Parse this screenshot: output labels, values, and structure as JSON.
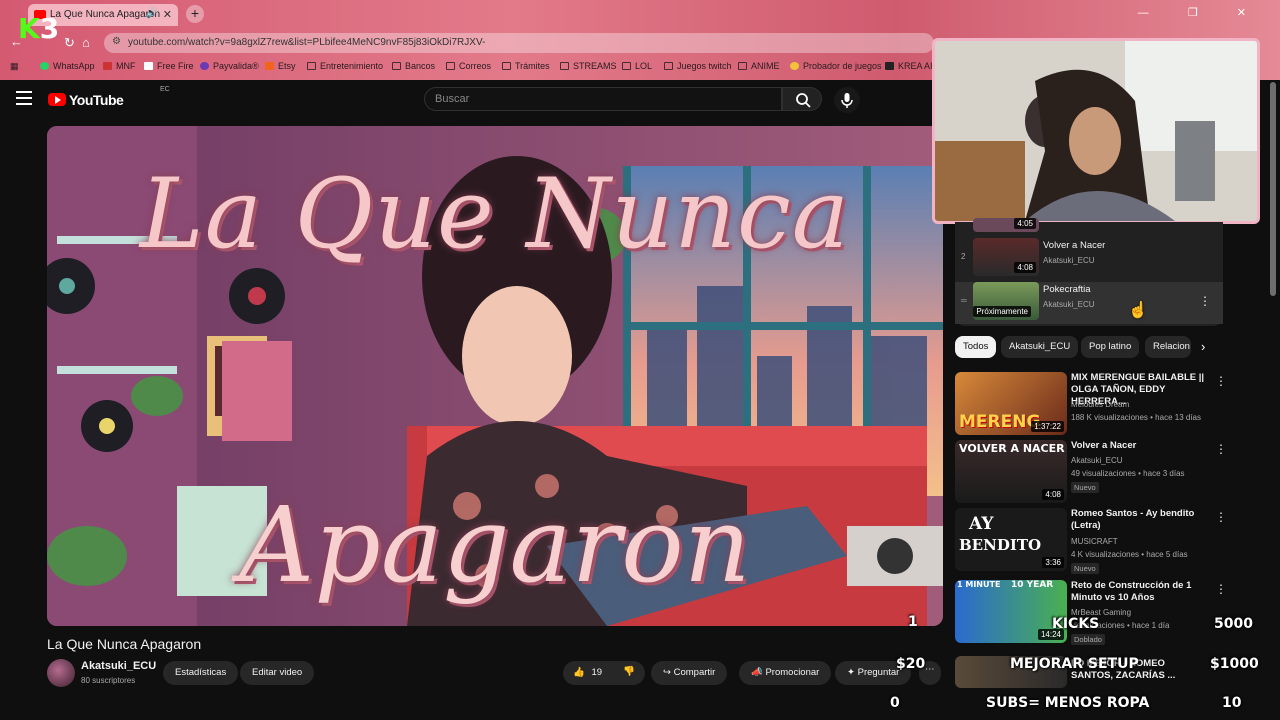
{
  "browser": {
    "tab_title": "La Que Nunca Apagaron",
    "url": "youtube.com/watch?v=9a8gxlZ7rew&list=PLbifee4MeNC9nvF85j83iOkDi7RJXV-",
    "bookmarks": [
      "WhatsApp",
      "MNF",
      "Free Fire",
      "Payvalida®",
      "Etsy",
      "Entretenimiento",
      "Bancos",
      "Correos",
      "Trámites",
      "STREAMS",
      "LOL",
      "Juegos twitch",
      "ANIME",
      "Probador de juegos",
      "KREA AI"
    ]
  },
  "overlay_logo": {
    "k": "K",
    "n": "3"
  },
  "youtube": {
    "logo": "YouTube",
    "country": "EC",
    "search_placeholder": "Buscar"
  },
  "video": {
    "thumb_title_top": "La Que Nunca",
    "thumb_title_bottom": "Apagaron",
    "title": "La Que Nunca Apagaron",
    "channel": "Akatsuki_ECU",
    "subscribers": "80 suscriptores",
    "buttons": {
      "stats": "Estadísticas",
      "edit": "Editar video",
      "likes": "19",
      "share": "Compartir",
      "promote": "Promocionar",
      "ask": "Preguntar"
    }
  },
  "playlist": [
    {
      "index": "",
      "title": "",
      "channel": "",
      "duration": "4:05"
    },
    {
      "index": "2",
      "title": "Volver a Nacer",
      "channel": "Akatsuki_ECU",
      "duration": "4:08"
    },
    {
      "index": "",
      "title": "Pokecraftia",
      "channel": "Akatsuki_ECU",
      "duration": "Próximamente"
    }
  ],
  "chips": [
    "Todos",
    "Akatsuki_ECU",
    "Pop latino",
    "Relacion"
  ],
  "recommendations": [
    {
      "title": "MIX MERENGUE BAILABLE || OLGA TAÑON, EDDY HERRERA...",
      "channel": "Melodies Dream",
      "meta": "188 K visualizaciones • hace 13 días",
      "duration": "1:37:22",
      "badge": ""
    },
    {
      "title": "Volver a Nacer",
      "channel": "Akatsuki_ECU",
      "meta": "49 visualizaciones • hace 3 días",
      "duration": "4:08",
      "badge": "Nuevo"
    },
    {
      "title": "Romeo Santos - Ay bendito (Letra)",
      "channel": "MUSICRAFT",
      "meta": "4 K visualizaciones • hace 5 días",
      "duration": "3:36",
      "badge": "Nuevo"
    },
    {
      "title": "Reto de Construcción de 1 Minuto vs 10 Años",
      "channel": "MrBeast Gaming",
      "meta": "visualizaciones • hace 1 día",
      "duration": "14:24",
      "badge": "Doblado"
    },
    {
      "title": "LO MEJOR - ROMEO SANTOS, ZACARÍAS ...",
      "channel": "",
      "meta": "",
      "duration": "",
      "badge": ""
    }
  ],
  "thumb_text": {
    "merengue": "MERENG",
    "volver": "VOLVER A NACER",
    "ay": "AY",
    "bendito": "BENDITO",
    "minute": "1 MINUTE",
    "year": "10 YEAR"
  },
  "stream_overlay": {
    "counter_1": "1",
    "goal_1_label": "KICKS",
    "goal_1_value": "5000",
    "goal_2_price": "$20",
    "goal_2_label": "MEJORAR SETUP",
    "goal_2_value": "$1000",
    "counter_0": "0",
    "goal_3_label": "SUBS= MENOS ROPA",
    "goal_3_value": "10"
  },
  "colors": {
    "yt_red": "#ff0000",
    "kick_green": "#53fc18",
    "chrome_pink": "#d45a72"
  }
}
